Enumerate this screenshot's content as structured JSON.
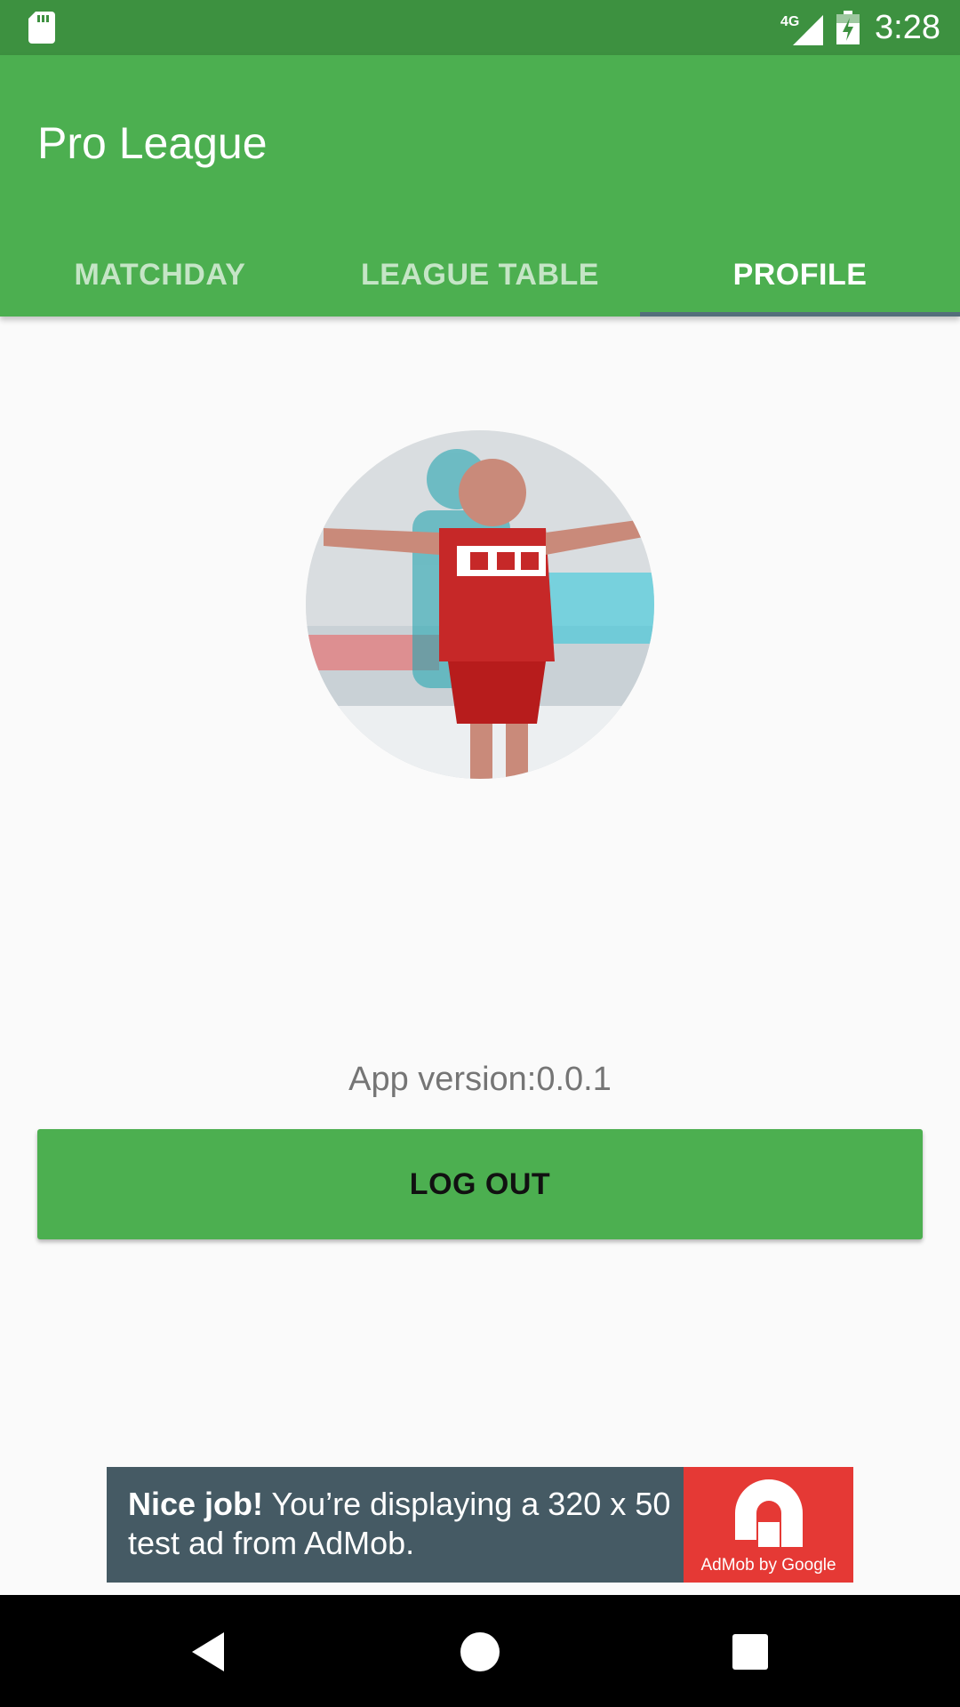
{
  "status_bar": {
    "network_label": "4G",
    "time": "3:28",
    "icons": [
      "sd-card-icon",
      "signal-icon",
      "battery-icon"
    ]
  },
  "app_bar": {
    "title": "Pro League",
    "tabs": [
      {
        "label": "MATCHDAY",
        "active": false
      },
      {
        "label": "LEAGUE TABLE",
        "active": false
      },
      {
        "label": "PROFILE",
        "active": true
      }
    ],
    "color": "#4caf50"
  },
  "profile": {
    "avatar_icon": "profile-photo",
    "app_version": "App version:0.0.1",
    "logout_label": "LOG OUT"
  },
  "ad": {
    "headline": "Nice job!",
    "body": "You’re displaying a 320 x 50 test ad from AdMob.",
    "logo_caption": "AdMob by Google",
    "colors": {
      "panel": "#455a64",
      "logo": "#e53935"
    }
  },
  "nav_bar": {
    "buttons": [
      "back-icon",
      "home-icon",
      "recents-icon"
    ]
  }
}
